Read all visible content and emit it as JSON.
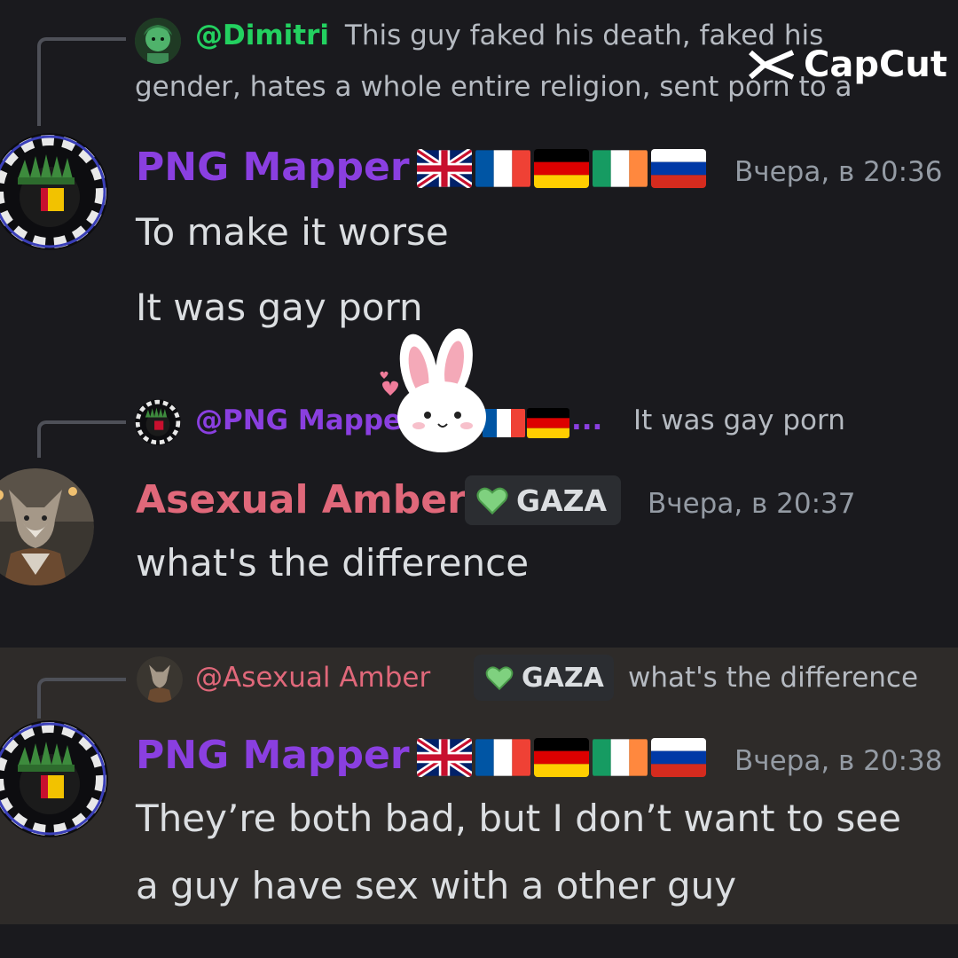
{
  "watermark": {
    "brand": "CapCut",
    "icon": "capcut-logo-icon"
  },
  "messages": [
    {
      "reply": {
        "mention": "@Dimitri",
        "text_line1": "This guy faked his death, faked his",
        "text_line2": "gender, hates a whole entire religion, sent porn to a"
      },
      "author": "PNG Mapper",
      "timestamp": "Вчера, в 20:36",
      "lines": [
        "To make it worse",
        "It was gay porn"
      ]
    },
    {
      "reply": {
        "mention": "@PNG Mapper",
        "ellipsis": "...",
        "text": "It was gay porn"
      },
      "author": "Asexual Amber",
      "tag": "GAZA",
      "timestamp": "Вчера, в 20:37",
      "lines": [
        "what's the difference"
      ]
    },
    {
      "reply": {
        "mention": "@Asexual Amber",
        "tag": "GAZA",
        "text": "what's the difference"
      },
      "author": "PNG Mapper",
      "timestamp": "Вчера, в 20:38",
      "lines": [
        "They’re both bad, but I don’t want to see",
        "a guy have sex with a other guy"
      ]
    }
  ],
  "flags": [
    "uk-flag-icon",
    "france-flag-icon",
    "germany-flag-icon",
    "ireland-flag-icon",
    "russia-flag-icon"
  ],
  "colors": {
    "background": "#1a1a1e",
    "highlight": "#2e2b29",
    "png_mapper_name": "#8a3fe0",
    "amber_name": "#e0687a",
    "dimitri_mention": "#23d160",
    "gaza_heart": "#7fd17f"
  }
}
